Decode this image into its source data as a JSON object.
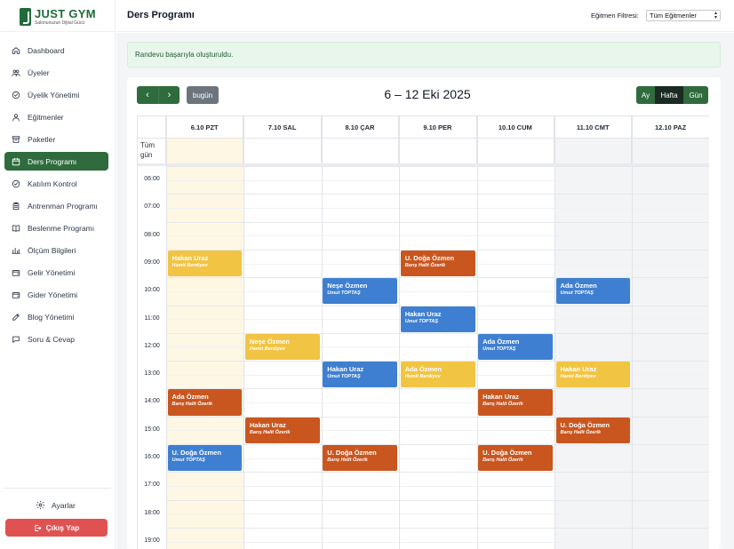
{
  "brand": {
    "title": "JUST GYM",
    "subtitle": "Salonunuzun Dijital Gücü",
    "color": "#1d6b38"
  },
  "sidebar": {
    "items": [
      {
        "label": "Dashboard",
        "icon": "home-icon",
        "active": false
      },
      {
        "label": "Üyeler",
        "icon": "users-icon",
        "active": false
      },
      {
        "label": "Üyelik Yönetimi",
        "icon": "check-circle-icon",
        "active": false
      },
      {
        "label": "Eğitmenler",
        "icon": "user-icon",
        "active": false
      },
      {
        "label": "Paketler",
        "icon": "archive-icon",
        "active": false
      },
      {
        "label": "Ders Programı",
        "icon": "calendar-icon",
        "active": true
      },
      {
        "label": "Katılım Kontrol",
        "icon": "check-circle-icon",
        "active": false
      },
      {
        "label": "Antrenman Programı",
        "icon": "clipboard-icon",
        "active": false
      },
      {
        "label": "Beslenme Programı",
        "icon": "book-icon",
        "active": false
      },
      {
        "label": "Ölçüm Bilgileri",
        "icon": "bar-chart-icon",
        "active": false
      },
      {
        "label": "Gelir Yönetimi",
        "icon": "wallet-icon",
        "active": false
      },
      {
        "label": "Gider Yönetimi",
        "icon": "wallet-icon",
        "active": false
      },
      {
        "label": "Blog Yönetimi",
        "icon": "edit-icon",
        "active": false
      },
      {
        "label": "Soru & Cevap",
        "icon": "chat-icon",
        "active": false
      }
    ],
    "settings_label": "Ayarlar",
    "logout_label": "Çıkış Yap"
  },
  "header": {
    "title": "Ders Programı",
    "filter_label": "Eğitmen Filtresi:",
    "filter_value": "Tüm Eğitmenler"
  },
  "alert": {
    "text": "Randevu başarıyla oluşturuldu."
  },
  "calendar": {
    "prev_label": "‹",
    "next_label": "›",
    "today_label": "bugün",
    "range_title": "6 – 12 Eki 2025",
    "views": {
      "month": "Ay",
      "week": "Hafta",
      "day": "Gün"
    },
    "active_view": "week",
    "allday_label": "Tüm gün",
    "days": [
      "6.10 PZT",
      "7.10 SAL",
      "8.10 ÇAR",
      "9.10 PER",
      "10.10 CUM",
      "11.10 CMT",
      "12.10 PAZ"
    ],
    "today_index": 0,
    "weekend_indexes": [
      5,
      6
    ],
    "times": [
      "06:00",
      "07:00",
      "08:00",
      "09:00",
      "10:00",
      "11:00",
      "12:00",
      "13:00",
      "14:00",
      "15:00",
      "16:00",
      "17:00",
      "18:00",
      "19:00"
    ],
    "colors": {
      "yellow": "#f2c443",
      "orange": "#c9561f",
      "blue": "#3f7fd1",
      "today": "#fdf7e4",
      "weekend": "#f3f4f6",
      "primary": "#2f6b3d"
    },
    "events": [
      {
        "title": "Hakan Uraz",
        "trainer": "Hamit Berdiyev",
        "day": 0,
        "start": "09:00",
        "color": "yellow"
      },
      {
        "title": "Ada Özmen",
        "trainer": "Barış Halit Özerik",
        "day": 0,
        "start": "14:00",
        "color": "orange"
      },
      {
        "title": "U. Doğa Özmen",
        "trainer": "Umut TOPTAŞ",
        "day": 0,
        "start": "16:00",
        "color": "blue"
      },
      {
        "title": "Neşe Özmen",
        "trainer": "Hamit Berdiyev",
        "day": 1,
        "start": "12:00",
        "color": "yellow"
      },
      {
        "title": "Hakan Uraz",
        "trainer": "Barış Halit Özerik",
        "day": 1,
        "start": "15:00",
        "color": "orange"
      },
      {
        "title": "Neşe Özmen",
        "trainer": "Umut TOPTAŞ",
        "day": 2,
        "start": "10:00",
        "color": "blue"
      },
      {
        "title": "Hakan Uraz",
        "trainer": "Umut TOPTAŞ",
        "day": 2,
        "start": "13:00",
        "color": "blue"
      },
      {
        "title": "U. Doğa Özmen",
        "trainer": "Barış Halit Özerik",
        "day": 2,
        "start": "16:00",
        "color": "orange"
      },
      {
        "title": "U. Doğa Özmen",
        "trainer": "Barış Halit Özerik",
        "day": 3,
        "start": "09:00",
        "color": "orange"
      },
      {
        "title": "Hakan Uraz",
        "trainer": "Umut TOPTAŞ",
        "day": 3,
        "start": "11:00",
        "color": "blue"
      },
      {
        "title": "Ada Özmen",
        "trainer": "Hamit Berdiyev",
        "day": 3,
        "start": "13:00",
        "color": "yellow"
      },
      {
        "title": "Ada Özmen",
        "trainer": "Umut TOPTAŞ",
        "day": 4,
        "start": "12:00",
        "color": "blue"
      },
      {
        "title": "Hakan Uraz",
        "trainer": "Barış Halit Özerik",
        "day": 4,
        "start": "14:00",
        "color": "orange"
      },
      {
        "title": "U. Doğa Özmen",
        "trainer": "Barış Halit Özerik",
        "day": 4,
        "start": "16:00",
        "color": "orange"
      },
      {
        "title": "Ada Özmen",
        "trainer": "Umut TOPTAŞ",
        "day": 5,
        "start": "10:00",
        "color": "blue"
      },
      {
        "title": "Hakan Uraz",
        "trainer": "Hamit Berdiyev",
        "day": 5,
        "start": "13:00",
        "color": "yellow"
      },
      {
        "title": "U. Doğa Özmen",
        "trainer": "Barış Halit Özerik",
        "day": 5,
        "start": "15:00",
        "color": "orange"
      }
    ]
  }
}
